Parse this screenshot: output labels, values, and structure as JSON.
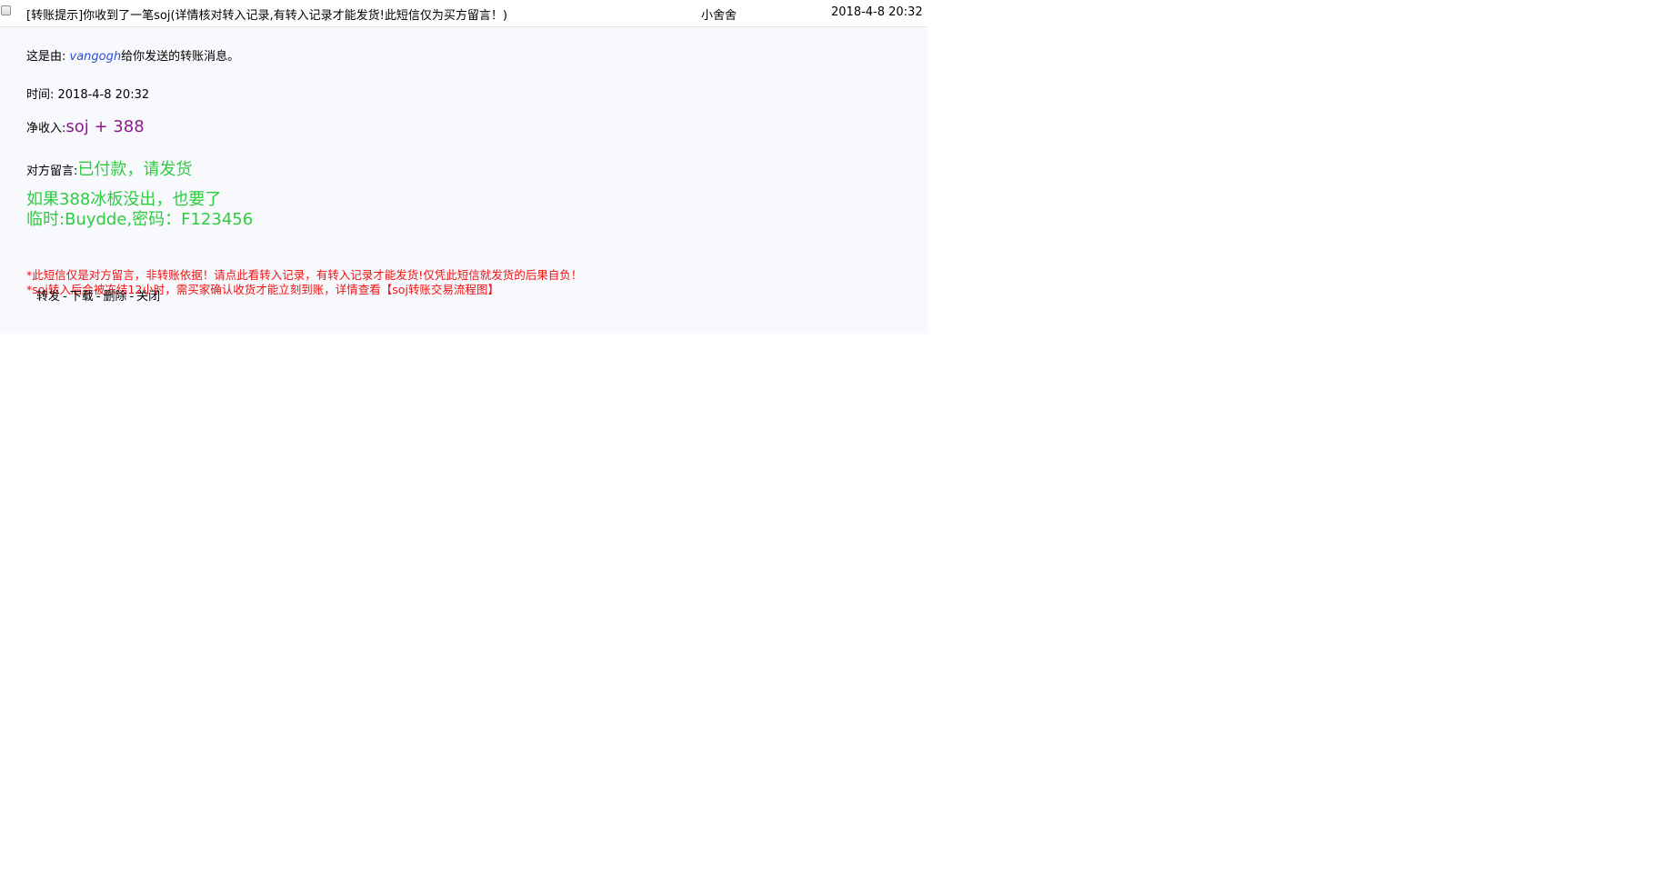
{
  "message": {
    "subject": "[转账提示]你收到了一笔soj(详情核对转入记录,有转入记录才能发货!此短信仅为买方留言！)",
    "sender": "小舍舍",
    "date": "2018-4-8 20:32"
  },
  "body": {
    "from_prefix": "这是由: ",
    "from_user": "vangogh",
    "from_suffix": "给你发送的转账消息。",
    "time_label": "时间: ",
    "time_value": "2018-4-8 20:32",
    "income_label": "净收入:",
    "income_value": "soj + 388",
    "note_label": "对方留言:",
    "note_line1": "已付款，请发货",
    "note_line2": "如果388冰板没出，也要了",
    "note_line3": "临时:Buydde,密码：F123456",
    "warning1": "*此短信仅是对方留言，非转账依据！请点此看转入记录，有转入记录才能发货!仅凭此短信就发货的后果自负！",
    "warning2": "*soj转入后会被冻结12小时，需买家确认收货才能立刻到账，详情查看【soj转账交易流程图】"
  },
  "actions": {
    "forward": "转发",
    "download": "下载",
    "delete": "删除",
    "close": "关闭",
    "separator": "-"
  },
  "colors": {
    "income": "#8b1a8b",
    "note": "#2ecc40",
    "warning": "#ee1111",
    "user_link": "#2b4fd6",
    "body_bg": "#f8f9fd"
  }
}
